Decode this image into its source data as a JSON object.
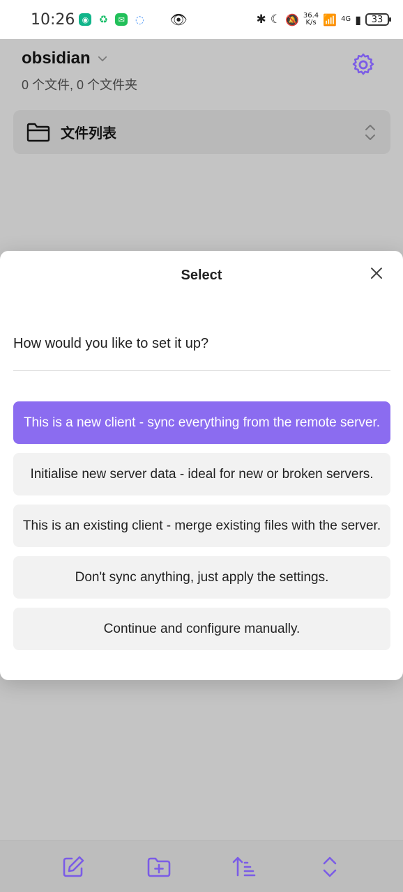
{
  "status_bar": {
    "time": "10:26",
    "speed": "36.4\nK/s",
    "network": "4G",
    "battery": "33"
  },
  "background_app": {
    "vault_name": "obsidian",
    "vault_meta": "0 个文件, 0 个文件夹",
    "file_list_label": "文件列表",
    "accent_color": "#8b6cf0"
  },
  "modal": {
    "title": "Select",
    "question": "How would you like to set it up?",
    "options": [
      {
        "label": "This is a new client - sync everything from the remote server.",
        "selected": true
      },
      {
        "label": "Initialise new server data - ideal for new or broken servers.",
        "selected": false
      },
      {
        "label": "This is an existing client - merge existing files with the server.",
        "selected": false
      },
      {
        "label": "Don't sync anything, just apply the settings.",
        "selected": false
      },
      {
        "label": "Continue and configure manually.",
        "selected": false
      }
    ]
  },
  "toolbar": {
    "icons": [
      "new-note-icon",
      "new-folder-icon",
      "sort-icon",
      "expand-collapse-icon"
    ]
  }
}
